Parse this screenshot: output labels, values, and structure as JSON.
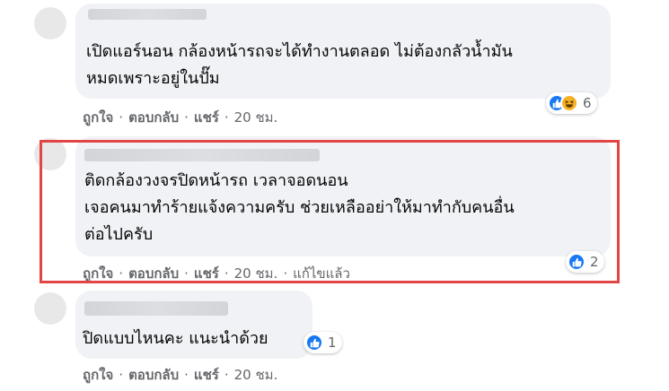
{
  "comments": [
    {
      "text_lines": [
        "เปิดแอร์นอน กล้องหน้ารถจะได้ทำงานตลอด ไม่ต้องกลัวน้ำมัน",
        "หมดเพราะอยู่ในปั๊ม"
      ],
      "actions": {
        "like": "ถูกใจ",
        "reply": "ตอบกลับ",
        "share": "แชร์",
        "time": "20 ชม."
      },
      "reactions": {
        "types": [
          "like-icon",
          "haha-icon"
        ],
        "count": "6"
      }
    },
    {
      "text_lines": [
        "ติดกล้องวงจรปิดหน้ารถ เวลาจอดนอน",
        "เจอคนมาทำร้ายแจ้งความครับ ช่วยเหลืออย่าให้มาทำกับคนอื่น",
        "ต่อไปครับ"
      ],
      "actions": {
        "like": "ถูกใจ",
        "reply": "ตอบกลับ",
        "share": "แชร์",
        "time": "20 ชม.",
        "edited": "แก้ไขแล้ว"
      },
      "reactions": {
        "types": [
          "like-icon"
        ],
        "count": "2"
      }
    },
    {
      "text_lines": [
        "ปิดแบบไหนคะ แนะนำด้วย"
      ],
      "actions": {
        "like": "ถูกใจ",
        "reply": "ตอบกลับ",
        "share": "แชร์",
        "time": "20 ชม."
      },
      "reactions": {
        "types": [
          "like-icon"
        ],
        "count": "1"
      }
    }
  ],
  "highlight_color": "#e24545",
  "accent_color": "#1877f2"
}
